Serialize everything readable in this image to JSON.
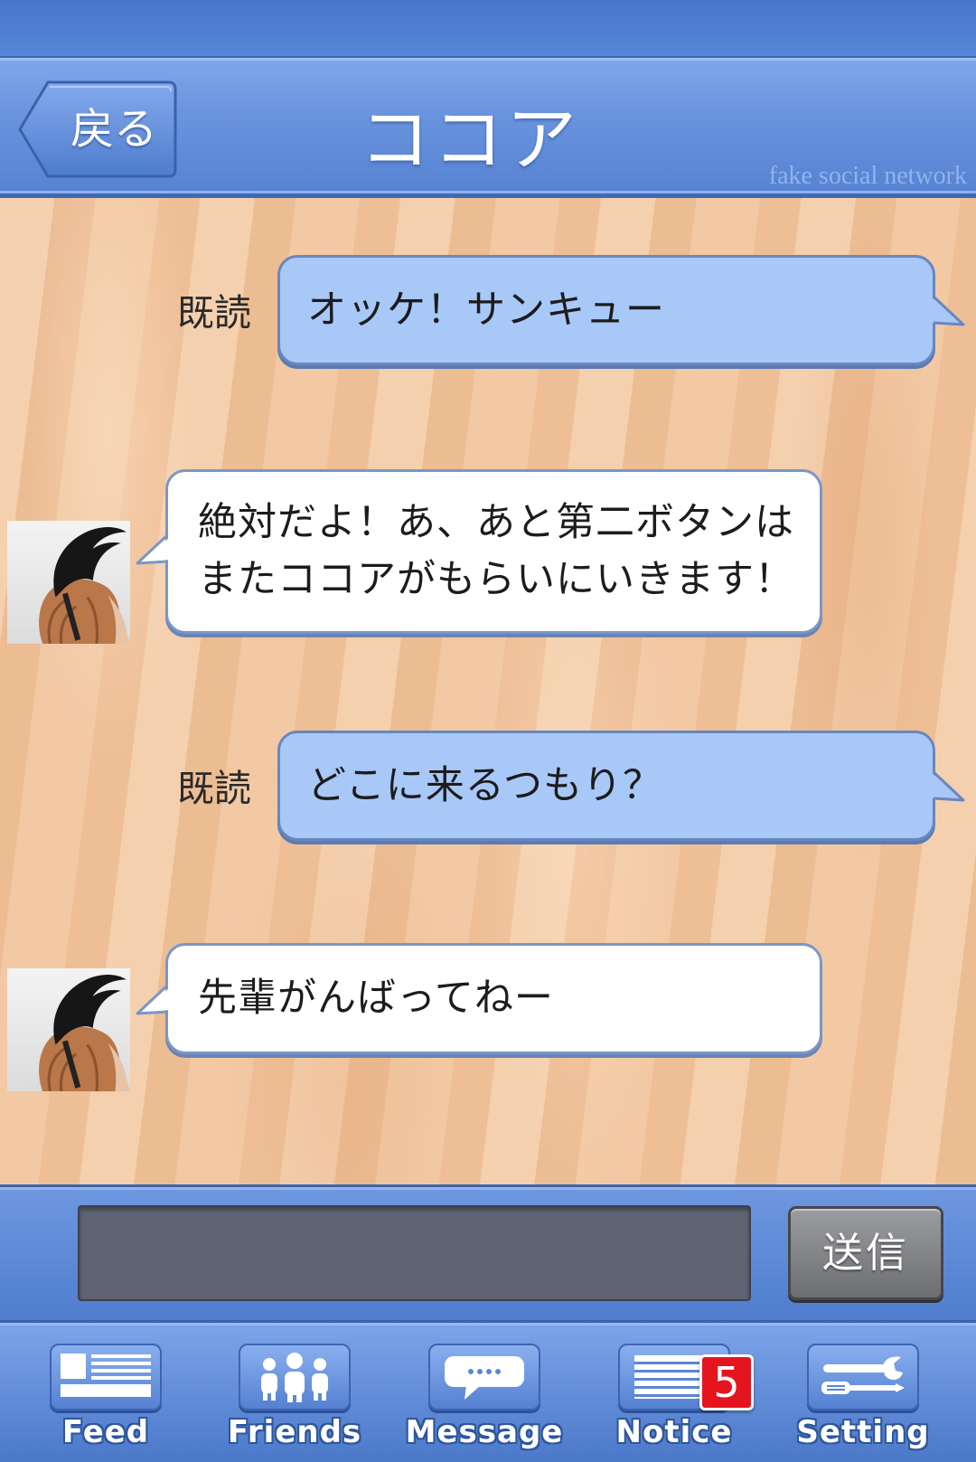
{
  "header": {
    "back_label": "戻る",
    "title": "ココア",
    "watermark": "fake social network"
  },
  "messages": [
    {
      "status": "既読",
      "text": "オッケ！サンキュー"
    },
    {
      "lines": [
        "絶対だよ！あ、あと第二ボタンは",
        "またココアがもらいにいきます！"
      ]
    },
    {
      "status": "既読",
      "text": "どこに来るつもり？"
    },
    {
      "text": "先輩がんばってねー"
    }
  ],
  "composer": {
    "input_value": "",
    "send_label": "送信"
  },
  "tabs": [
    {
      "label": "Feed",
      "icon": "newspaper-icon"
    },
    {
      "label": "Friends",
      "icon": "people-icon"
    },
    {
      "label": "Message",
      "icon": "speech-bubble-icon"
    },
    {
      "label": "Notice",
      "icon": "list-icon",
      "badge": "5"
    },
    {
      "label": "Setting",
      "icon": "tools-icon"
    }
  ],
  "colors": {
    "header_blue": "#6a94de",
    "sent_bubble": "#a8c8f8",
    "received_bubble": "#ffffff",
    "badge_red": "#e4151e",
    "input_field": "#5f6473"
  }
}
